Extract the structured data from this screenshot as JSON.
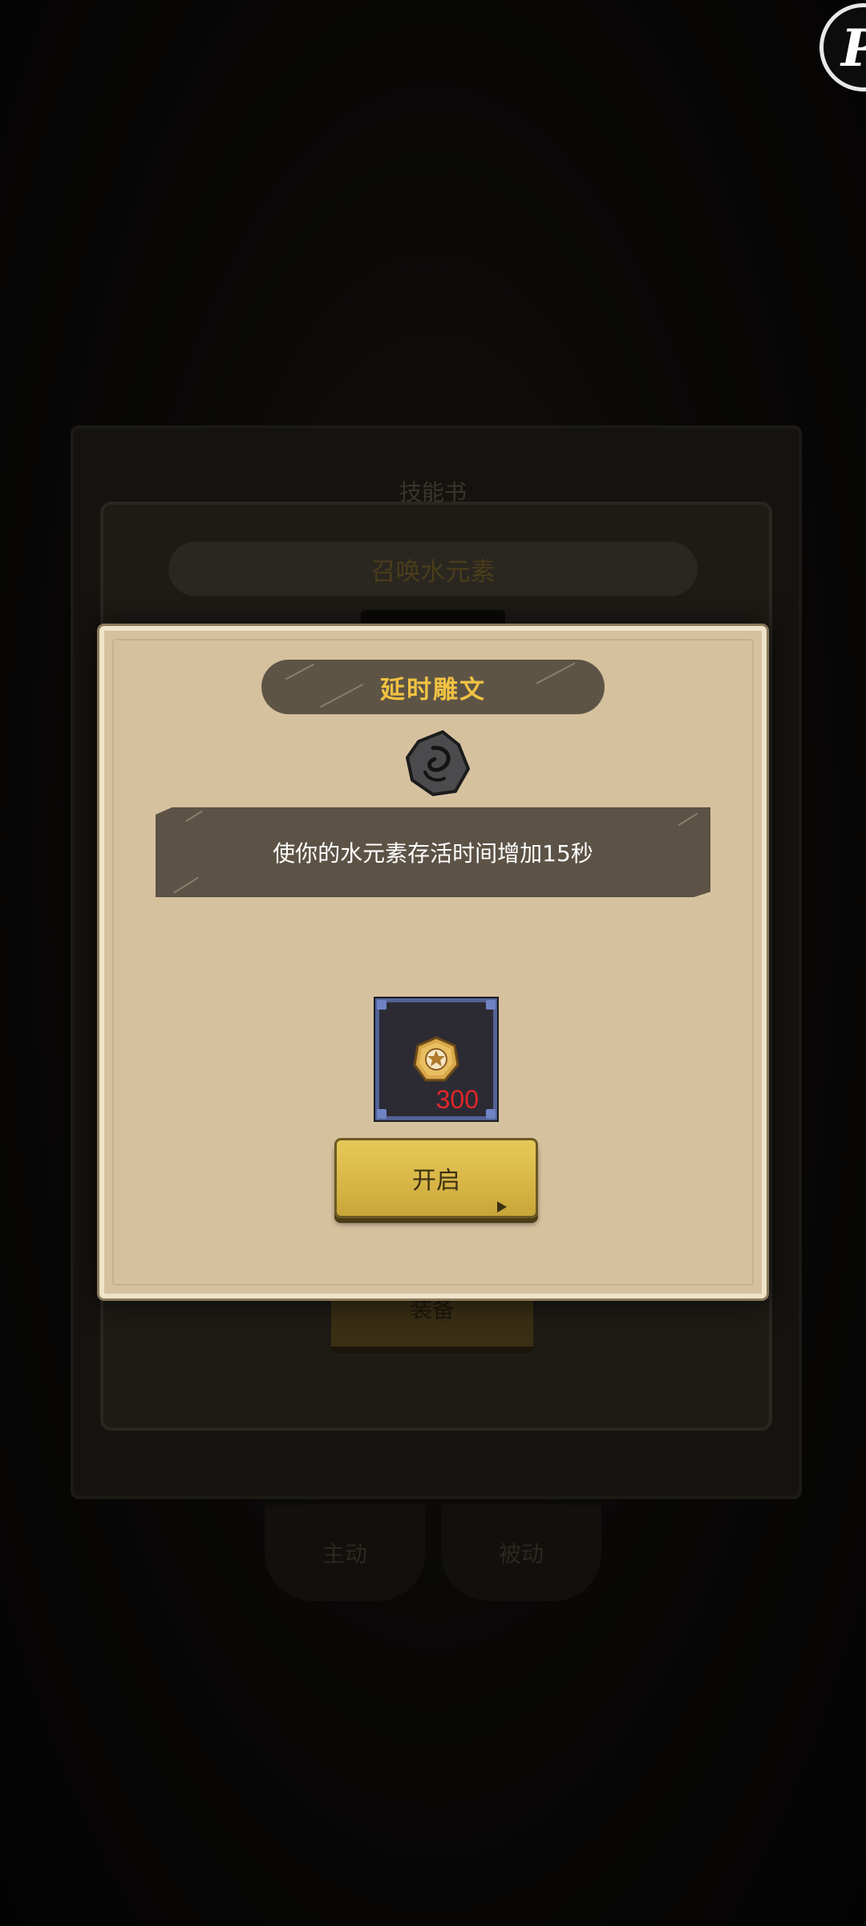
{
  "background": {
    "header_text": "技能书",
    "dialog_title": "召唤水元素",
    "button_label": "装备",
    "bottom_tabs": [
      "主动",
      "被动"
    ]
  },
  "corner_button": {
    "glyph": "P"
  },
  "popup": {
    "title": "延时雕文",
    "rune_icon": "rune-stone-icon",
    "description": "使你的水元素存活时间增加15秒",
    "cost": {
      "icon": "gold-coin-icon",
      "amount": "300"
    },
    "open_button_label": "开启"
  },
  "colors": {
    "parchment": "#d6c19f",
    "banner": "#5e5446",
    "title_text": "#f1c242",
    "cost_text": "#e0262a",
    "slot_border": "#536295",
    "button_gold": "#d7b545"
  }
}
